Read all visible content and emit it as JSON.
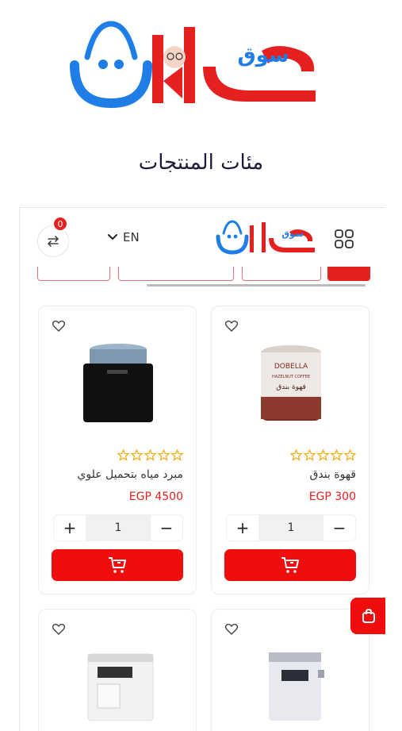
{
  "hero": {
    "logo_text_main": "عدلات",
    "logo_text_sub": "سوق",
    "tagline": "مئات المنتجات"
  },
  "header": {
    "compare_count": "0",
    "language": "EN",
    "logo_text_main": "عدلات",
    "logo_text_sub": "سوق",
    "icons": [
      "compare-arrows-icon",
      "chevron-down-icon",
      "grid-icon"
    ]
  },
  "products": [
    {
      "name": "قهوة بندق",
      "price": "EGP 300",
      "quantity": "1",
      "rating": 0,
      "image_label": "DOBELLA",
      "image_sub": "HAZELNUT COFFEE",
      "image_ar": "قهوة بندق"
    },
    {
      "name": "مبرد مياه بتحميل علوي",
      "price": "EGP 4500",
      "quantity": "1",
      "rating": 0
    },
    {
      "name": "",
      "price": "",
      "quantity": "",
      "rating": 0
    },
    {
      "name": "",
      "price": "",
      "quantity": "",
      "rating": 0
    }
  ],
  "colors": {
    "brand_red": "#ee0e0e",
    "brand_blue": "#1e7ee6",
    "star": "#f2b01e"
  }
}
